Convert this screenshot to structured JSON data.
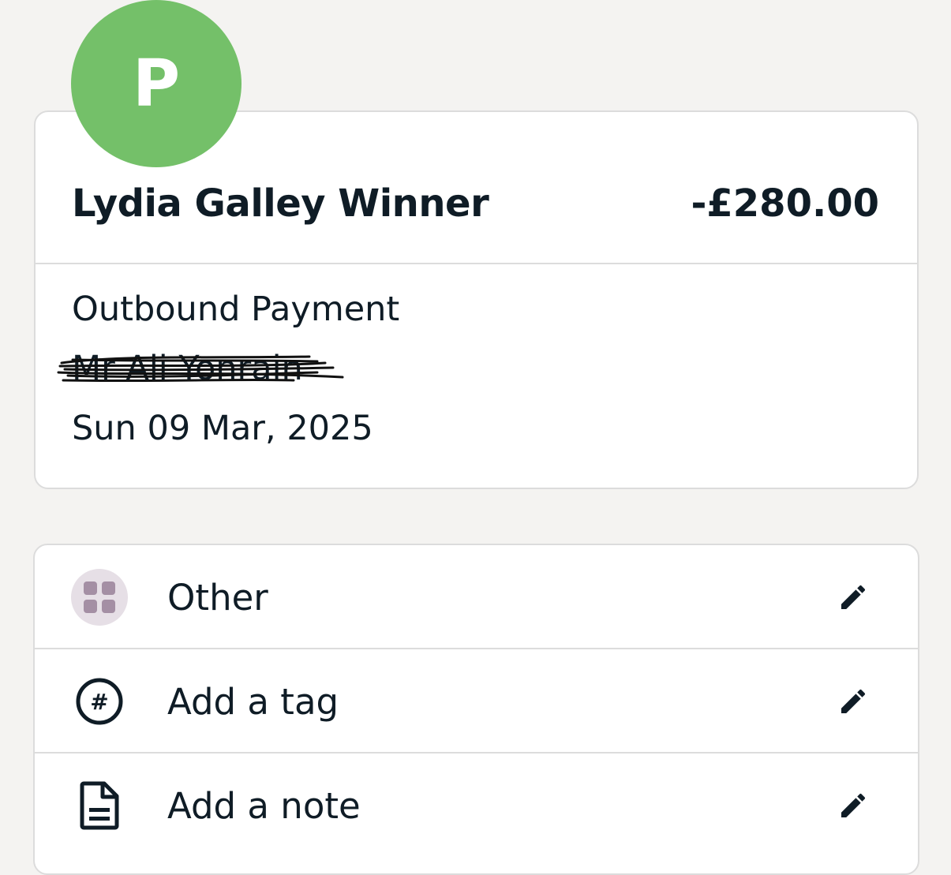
{
  "transaction": {
    "avatar_initial": "P",
    "merchant_name": "Lydia Galley Winner",
    "amount": "-£280.00",
    "type": "Outbound Payment",
    "reference": "Mr Ali Yonrain",
    "date": "Sun 09 Mar, 2025"
  },
  "meta_rows": [
    {
      "label": "Other",
      "icon": "category-grid-icon"
    },
    {
      "label": "Add a tag",
      "icon": "hashtag-icon"
    },
    {
      "label": "Add a note",
      "icon": "note-icon"
    }
  ],
  "colors": {
    "avatar_bg": "#74c069",
    "text": "#0f1c26",
    "page_bg": "#f4f3f1",
    "category_bubble": "#e6dfe6",
    "category_tiles": "#a48fa4"
  }
}
